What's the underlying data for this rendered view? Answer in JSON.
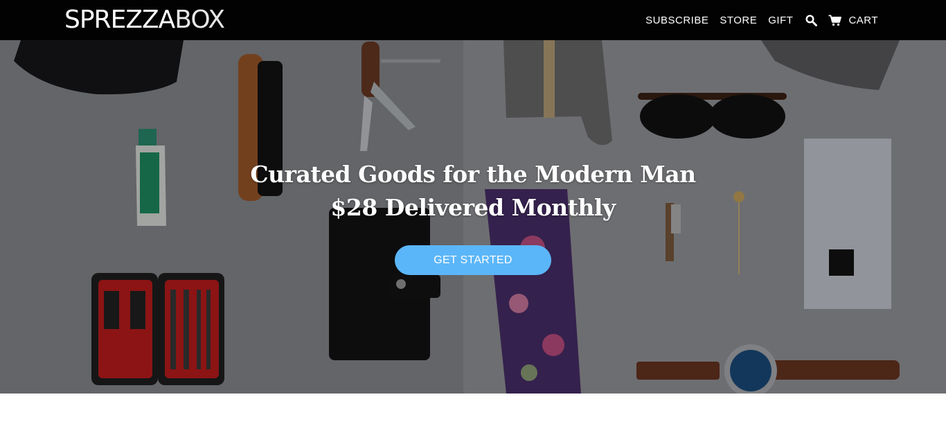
{
  "header": {
    "logo": {
      "part1": "SPREZZA",
      "part2": "BOX"
    },
    "nav": [
      {
        "label": "SUBSCRIBE"
      },
      {
        "label": "STORE"
      },
      {
        "label": "GIFT"
      }
    ],
    "search_icon": "search-icon",
    "cart": {
      "icon": "cart-icon",
      "label": "CART"
    }
  },
  "hero": {
    "headline_line1": "Curated Goods for the Modern Man",
    "headline_line2": "$28 Delivered Monthly",
    "cta_label": "GET STARTED",
    "colors": {
      "cta_background": "#5bb6f9",
      "header_background": "#020202"
    }
  }
}
